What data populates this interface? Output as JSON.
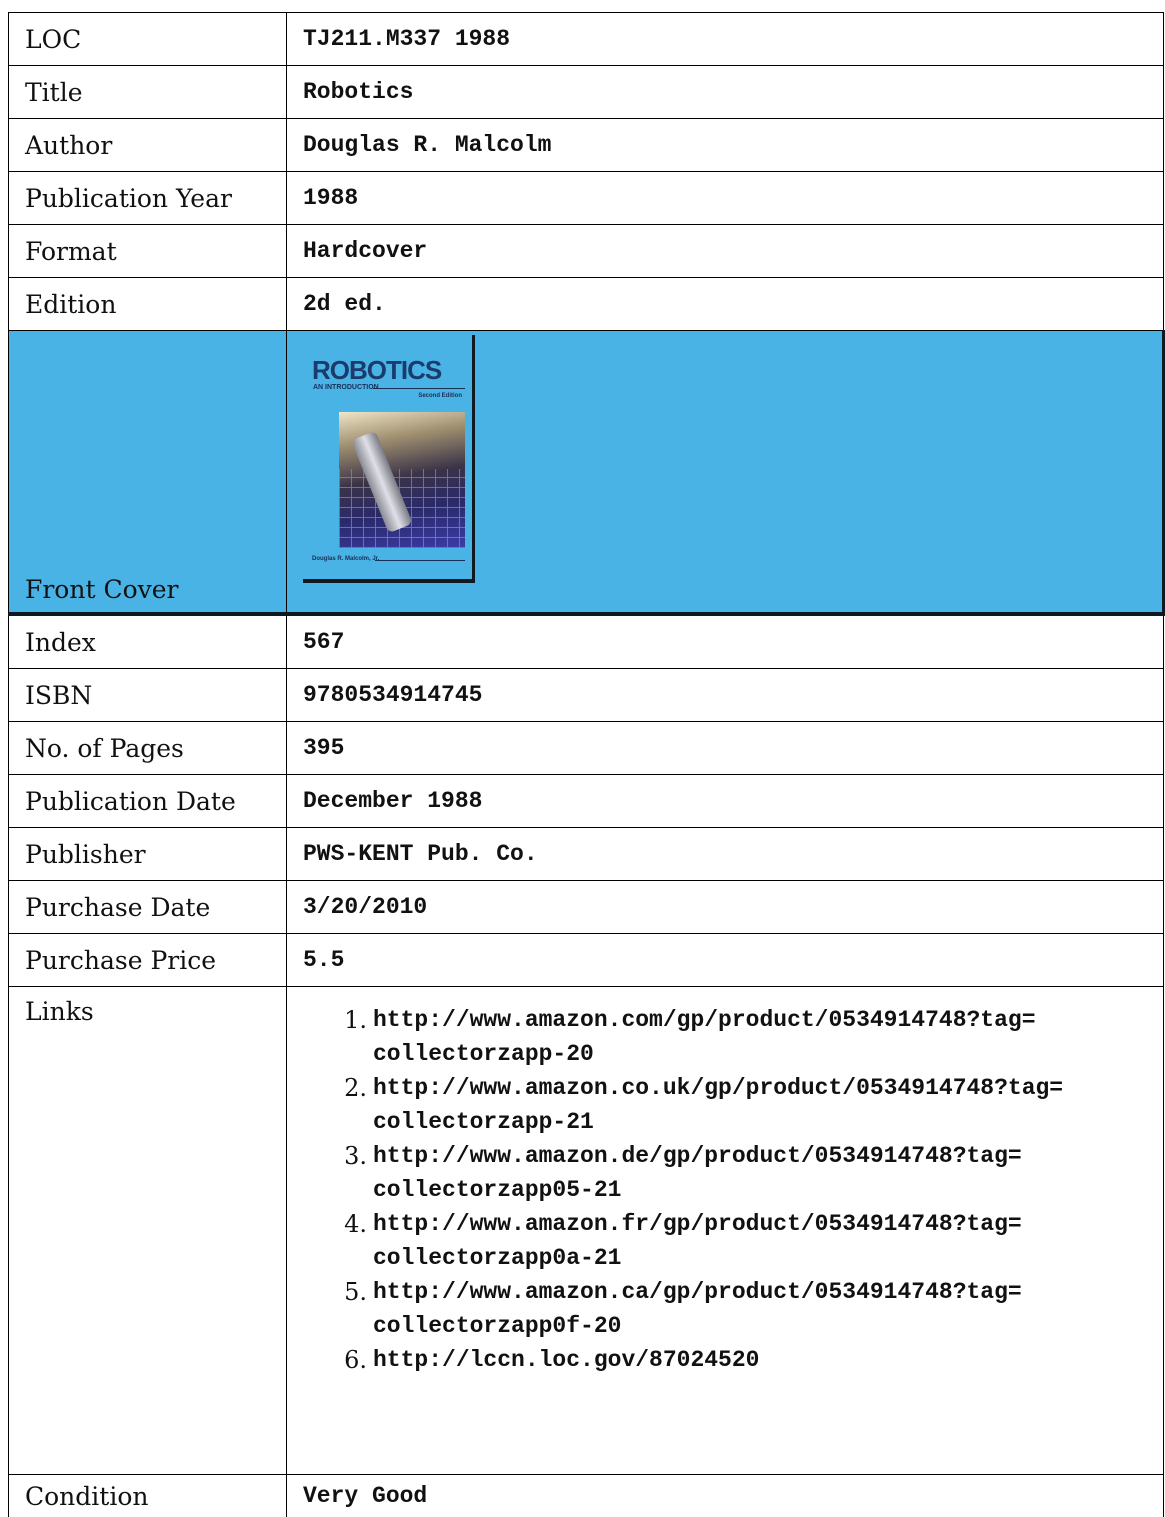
{
  "rows": {
    "loc": {
      "label": "LOC",
      "value": "TJ211.M337 1988"
    },
    "title": {
      "label": "Title",
      "value": "Robotics"
    },
    "author": {
      "label": "Author",
      "value": "Douglas R. Malcolm"
    },
    "pub_year": {
      "label": "Publication Year",
      "value": "1988"
    },
    "format": {
      "label": "Format",
      "value": "Hardcover"
    },
    "edition": {
      "label": "Edition",
      "value": "2d ed."
    },
    "front_cover": {
      "label": "Front Cover"
    },
    "index": {
      "label": "Index",
      "value": "567"
    },
    "isbn": {
      "label": "ISBN",
      "value": "9780534914745"
    },
    "pages": {
      "label": "No. of Pages",
      "value": "395"
    },
    "pub_date": {
      "label": "Publication Date",
      "value": "December 1988"
    },
    "publisher": {
      "label": "Publisher",
      "value": "PWS-KENT Pub. Co."
    },
    "purchase_date": {
      "label": "Purchase Date",
      "value": "3/20/2010"
    },
    "purchase_price": {
      "label": "Purchase Price",
      "value": "5.5"
    },
    "links": {
      "label": "Links"
    },
    "condition": {
      "label": "Condition",
      "value": "Very Good"
    }
  },
  "links": [
    {
      "line1": "http://www.amazon.com/gp/product/0534914748?tag=",
      "line2": "collectorzapp-20"
    },
    {
      "line1": "http://www.amazon.co.uk/gp/product/0534914748?tag=",
      "line2": "collectorzapp-21"
    },
    {
      "line1": "http://www.amazon.de/gp/product/0534914748?tag=",
      "line2": "collectorzapp05-21"
    },
    {
      "line1": "http://www.amazon.fr/gp/product/0534914748?tag=",
      "line2": "collectorzapp0a-21"
    },
    {
      "line1": "http://www.amazon.ca/gp/product/0534914748?tag=",
      "line2": "collectorzapp0f-20"
    },
    {
      "line1": "http://lccn.loc.gov/87024520",
      "line2": ""
    }
  ],
  "cover": {
    "title": "ROBOTICS",
    "subtitle": "AN INTRODUCTION",
    "edition": "Second Edition",
    "author": "Douglas R. Malcolm, Jr.",
    "background_color": "#4ab3e6",
    "title_color": "#1a3b6c"
  }
}
